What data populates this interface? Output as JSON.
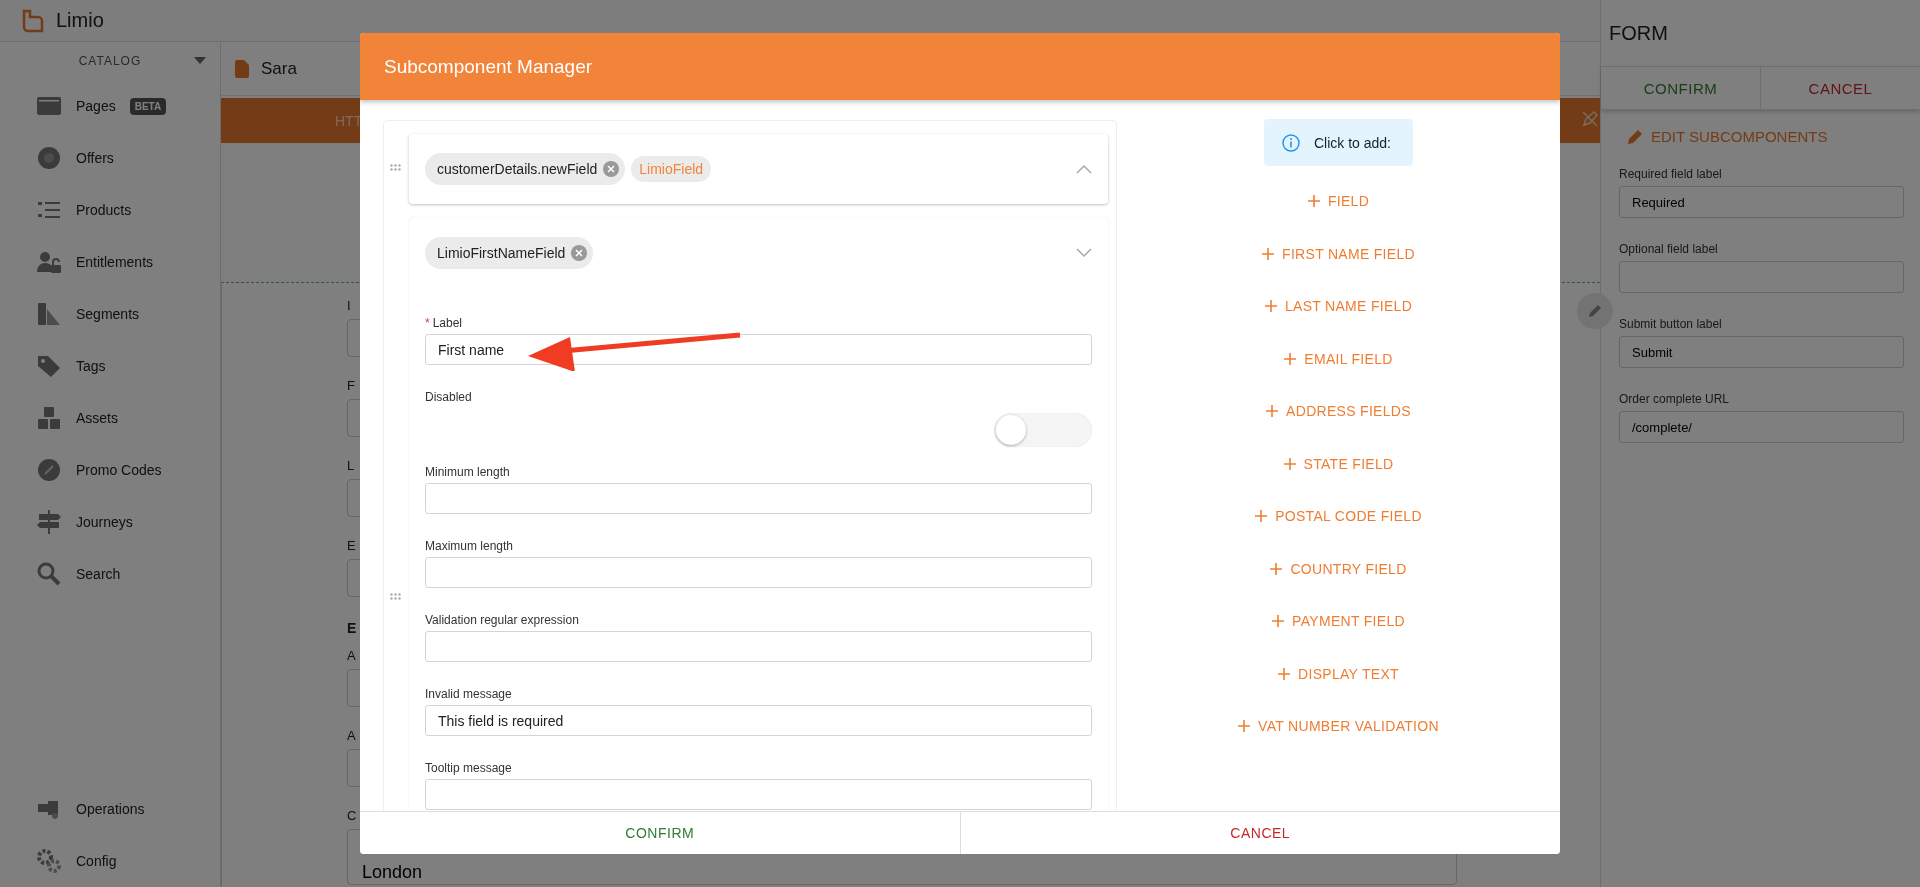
{
  "app": {
    "logo": "Limio"
  },
  "sidebar": {
    "section": "CATALOG",
    "items": [
      {
        "label": "Pages",
        "badge": "BETA"
      },
      {
        "label": "Offers"
      },
      {
        "label": "Products"
      },
      {
        "label": "Entitlements"
      },
      {
        "label": "Segments"
      },
      {
        "label": "Tags"
      },
      {
        "label": "Assets"
      },
      {
        "label": "Promo Codes"
      },
      {
        "label": "Journeys"
      },
      {
        "label": "Search"
      }
    ],
    "bottom_items": [
      {
        "label": "Operations"
      },
      {
        "label": "Config"
      }
    ]
  },
  "page": {
    "title": "Sara",
    "banner": "HTT",
    "form": [
      {
        "kind": "field",
        "label": "I"
      },
      {
        "kind": "field",
        "label": "F"
      },
      {
        "kind": "field",
        "label": "L"
      },
      {
        "kind": "field",
        "label": "E"
      },
      {
        "kind": "heading",
        "label": "E"
      },
      {
        "kind": "field",
        "label": "A"
      },
      {
        "kind": "field",
        "label": "A"
      },
      {
        "kind": "field",
        "label": "C",
        "value": "London"
      }
    ]
  },
  "panel": {
    "title": "FORM",
    "actions": [
      {
        "label": "CONFIRM",
        "kind": "confirm"
      },
      {
        "label": "CANCEL",
        "kind": "cancel"
      }
    ],
    "edit_link": "EDIT SUBCOMPONENTS",
    "fields": [
      {
        "label": "Required field label",
        "value": "Required"
      },
      {
        "label": "Optional field label"
      },
      {
        "label": "Submit button label",
        "value": "Submit"
      },
      {
        "label": "Order complete URL",
        "value": "/complete/"
      }
    ]
  },
  "modal": {
    "title": "Subcomponent Manager",
    "components": [
      {
        "name": "customerDetails.newField",
        "type": "LimioField",
        "expanded": false
      },
      {
        "name": "LimioFirstNameField",
        "expanded": true,
        "fields": [
          {
            "kind": "text",
            "label": "Label",
            "required_mark": "*",
            "value": "First name"
          },
          {
            "kind": "toggle",
            "label": "Disabled",
            "on": false
          },
          {
            "kind": "text",
            "label": "Minimum length"
          },
          {
            "kind": "text",
            "label": "Maximum length"
          },
          {
            "kind": "text",
            "label": "Validation regular expression"
          },
          {
            "kind": "text",
            "label": "Invalid message",
            "value": "This field is required"
          },
          {
            "kind": "text",
            "label": "Tooltip message"
          }
        ]
      }
    ],
    "hint": "Click to add:",
    "add_buttons": [
      "FIELD",
      "FIRST NAME FIELD",
      "LAST NAME FIELD",
      "EMAIL FIELD",
      "ADDRESS FIELDS",
      "STATE FIELD",
      "POSTAL CODE FIELD",
      "COUNTRY FIELD",
      "PAYMENT FIELD",
      "DISPLAY TEXT",
      "VAT NUMBER VALIDATION"
    ],
    "actions": [
      {
        "label": "CONFIRM",
        "kind": "confirm"
      },
      {
        "label": "CANCEL",
        "kind": "cancel"
      }
    ]
  }
}
